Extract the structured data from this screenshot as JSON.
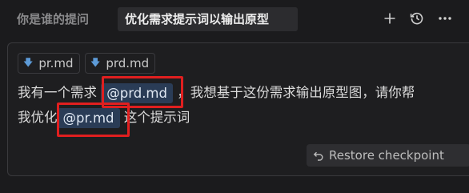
{
  "tabs": {
    "inactive": "你是谁的提问",
    "active": "优化需求提示词以输出原型"
  },
  "toolbar": {
    "add_icon": "plus-icon",
    "history_icon": "history-icon",
    "more_icon": "more-icon"
  },
  "chips": [
    {
      "icon": "file-arrow-icon",
      "label": "pr.md"
    },
    {
      "icon": "file-arrow-icon",
      "label": "prd.md"
    }
  ],
  "message": {
    "line1_before": "我有一个需求",
    "mention1": "@prd.md",
    "line1_after": "，我想基于这份需求输出原型图，请你帮",
    "line2_before": "我优化",
    "mention2": "@pr.md",
    "line2_after": "这个提示词"
  },
  "restore": {
    "label": "Restore checkpoint",
    "icon": "undo-arrow-icon"
  },
  "colors": {
    "accent_mention": "#2a3c56",
    "highlight": "#e01f1f",
    "arrow": "#5d9bd8"
  }
}
